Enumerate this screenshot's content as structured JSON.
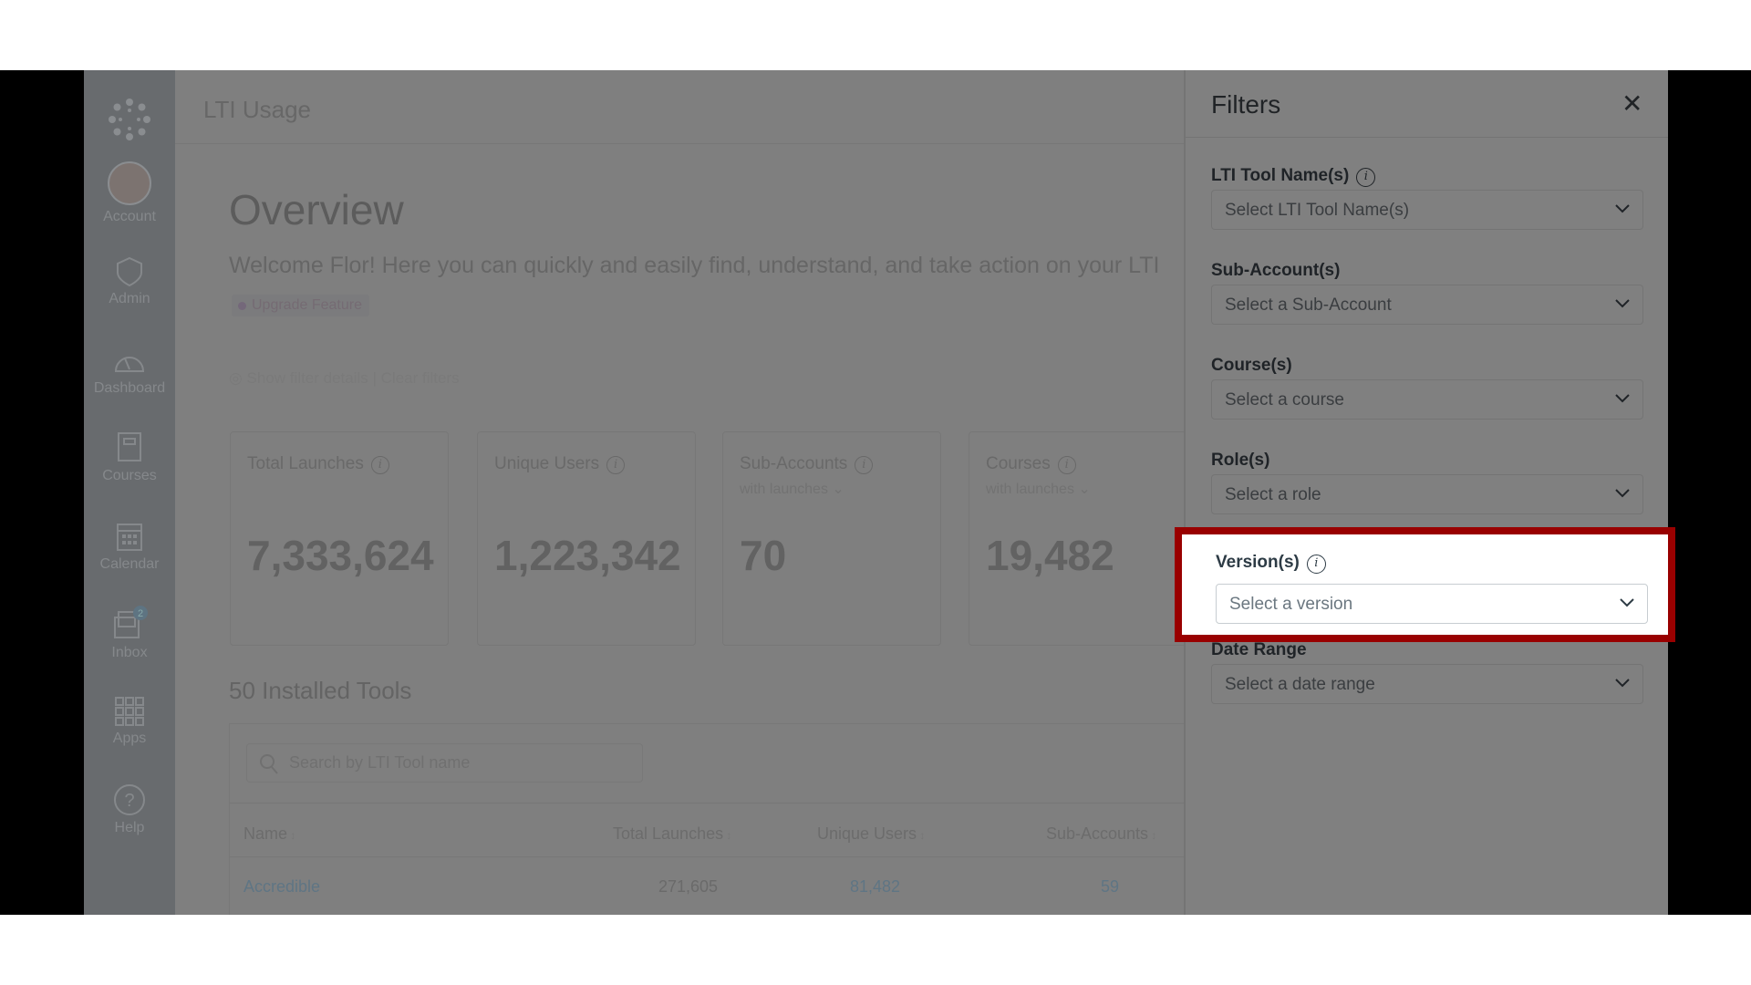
{
  "sidebar": {
    "items": [
      {
        "label": "Account",
        "icon": "avatar-icon"
      },
      {
        "label": "Admin",
        "icon": "shield-icon"
      },
      {
        "label": "Dashboard",
        "icon": "dashboard-icon"
      },
      {
        "label": "Courses",
        "icon": "book-icon"
      },
      {
        "label": "Calendar",
        "icon": "calendar-icon"
      },
      {
        "label": "Inbox",
        "icon": "inbox-icon",
        "badge": "2"
      },
      {
        "label": "Apps",
        "icon": "apps-icon"
      },
      {
        "label": "Help",
        "icon": "help-icon"
      }
    ]
  },
  "header": {
    "title": "LTI Usage"
  },
  "main": {
    "title": "Overview",
    "welcome": "Welcome Flor! Here you can quickly and easily find, understand, and take action on your LTI",
    "badge": "Upgrade Feature",
    "filter_links": "◎ Show filter details | Clear filters",
    "cards": [
      {
        "title": "Total Launches",
        "sub": "",
        "value": "7,333,624"
      },
      {
        "title": "Unique Users",
        "sub": "",
        "value": "1,223,342"
      },
      {
        "title": "Sub-Accounts",
        "sub": "with launches",
        "value": "70"
      },
      {
        "title": "Courses",
        "sub": "with launches",
        "value": "19,482"
      }
    ],
    "installed_title": "50 Installed Tools",
    "search_placeholder": "Search by LTI Tool name",
    "columns": [
      "Name",
      "Total Launches",
      "Unique Users",
      "Sub-Accounts"
    ],
    "rows": [
      [
        "Accredible",
        "271,605",
        "81,482",
        "59"
      ]
    ]
  },
  "filters": {
    "title": "Filters",
    "close": "✕",
    "fields": [
      {
        "label": "LTI Tool Name(s)",
        "info": true,
        "placeholder": "Select LTI Tool Name(s)"
      },
      {
        "label": "Sub-Account(s)",
        "info": false,
        "placeholder": "Select a Sub-Account"
      },
      {
        "label": "Course(s)",
        "info": false,
        "placeholder": "Select a course"
      },
      {
        "label": "Role(s)",
        "info": false,
        "placeholder": "Select a role"
      },
      {
        "label": "Version(s)",
        "info": true,
        "placeholder": "Select a version"
      },
      {
        "label": "Date Range",
        "info": false,
        "placeholder": "Select a date range"
      }
    ]
  },
  "colors": {
    "highlight": "#990000",
    "link": "#0374b5",
    "overlay": "#808080"
  }
}
